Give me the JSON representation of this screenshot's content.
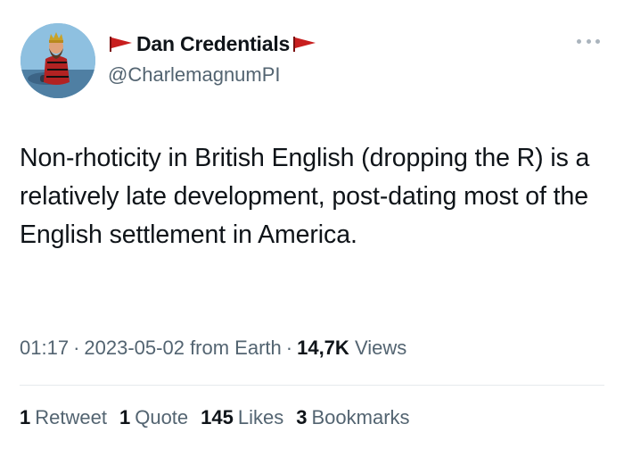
{
  "author": {
    "display_name": "Dan Credentials",
    "handle": "@CharlemagnumPI",
    "avatar_icon": "profile-avatar",
    "name_decoration_icon": "red-flag-icon",
    "flag_color": "#c81e1e"
  },
  "tweet": {
    "text": "Non-rhoticity in British English (dropping the R) is a relatively late development, post-dating most of the English settlement in America."
  },
  "meta": {
    "time": "01:17",
    "date": "2023-05-02",
    "source": "from Earth",
    "views_count": "14,7K",
    "views_label": "Views",
    "separator": "·"
  },
  "stats": [
    {
      "count": "1",
      "label": "Retweet"
    },
    {
      "count": "1",
      "label": "Quote"
    },
    {
      "count": "145",
      "label": "Likes"
    },
    {
      "count": "3",
      "label": "Bookmarks"
    }
  ],
  "colors": {
    "text_primary": "#0f1419",
    "text_secondary": "#536471",
    "divider": "#e6e9ec"
  }
}
